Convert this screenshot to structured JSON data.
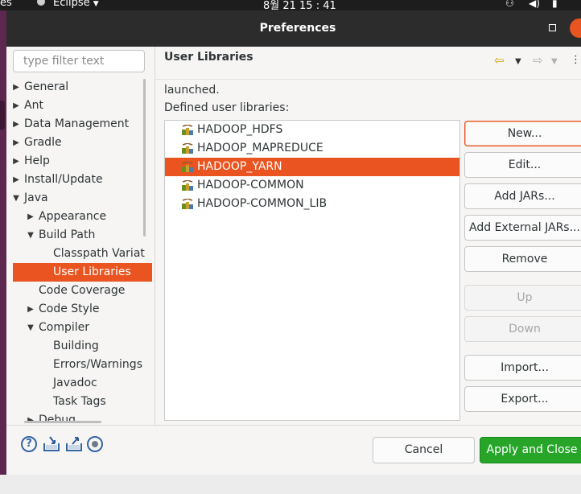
{
  "topbar": {
    "app_fragment": "es",
    "app_name": "Eclipse",
    "clock": "8월 21  15 : 41"
  },
  "window": {
    "title": "Preferences"
  },
  "filter": {
    "placeholder": "type filter text"
  },
  "tree": [
    {
      "label": "General",
      "expander": "collapsed"
    },
    {
      "label": "Ant",
      "expander": "collapsed"
    },
    {
      "label": "Data Management",
      "expander": "collapsed"
    },
    {
      "label": "Gradle",
      "expander": "collapsed"
    },
    {
      "label": "Help",
      "expander": "collapsed"
    },
    {
      "label": "Install/Update",
      "expander": "collapsed"
    },
    {
      "label": "Java",
      "expander": "expanded"
    },
    {
      "label": "Appearance",
      "expander": "collapsed"
    },
    {
      "label": "Build Path",
      "expander": "expanded"
    },
    {
      "label": "Classpath Variat",
      "expander": "none"
    },
    {
      "label": "User Libraries",
      "expander": "none",
      "selected": true
    },
    {
      "label": "Code Coverage",
      "expander": "none"
    },
    {
      "label": "Code Style",
      "expander": "collapsed"
    },
    {
      "label": "Compiler",
      "expander": "expanded"
    },
    {
      "label": "Building",
      "expander": "none"
    },
    {
      "label": "Errors/Warnings",
      "expander": "none"
    },
    {
      "label": "Javadoc",
      "expander": "none"
    },
    {
      "label": "Task Tags",
      "expander": "none"
    },
    {
      "label": "Debug",
      "expander": "collapsed"
    }
  ],
  "page": {
    "title": "User Libraries",
    "description_tail": "launched.",
    "list_label": "Defined user libraries:"
  },
  "libraries": [
    {
      "name": "HADOOP_HDFS"
    },
    {
      "name": "HADOOP_MAPREDUCE"
    },
    {
      "name": "HADOOP_YARN",
      "selected": true
    },
    {
      "name": "HADOOP-COMMON"
    },
    {
      "name": "HADOOP-COMMON_LIB"
    }
  ],
  "buttons": {
    "new": "New...",
    "edit": "Edit...",
    "add_jars": "Add JARs...",
    "add_external_jars": "Add External JARs...",
    "remove": "Remove",
    "up": "Up",
    "down": "Down",
    "import": "Import...",
    "export": "Export..."
  },
  "footer": {
    "cancel": "Cancel",
    "apply_close": "Apply and Close"
  },
  "colors": {
    "selection": "#e95420",
    "apply": "#26a529",
    "window_accent": "#5e2750"
  }
}
